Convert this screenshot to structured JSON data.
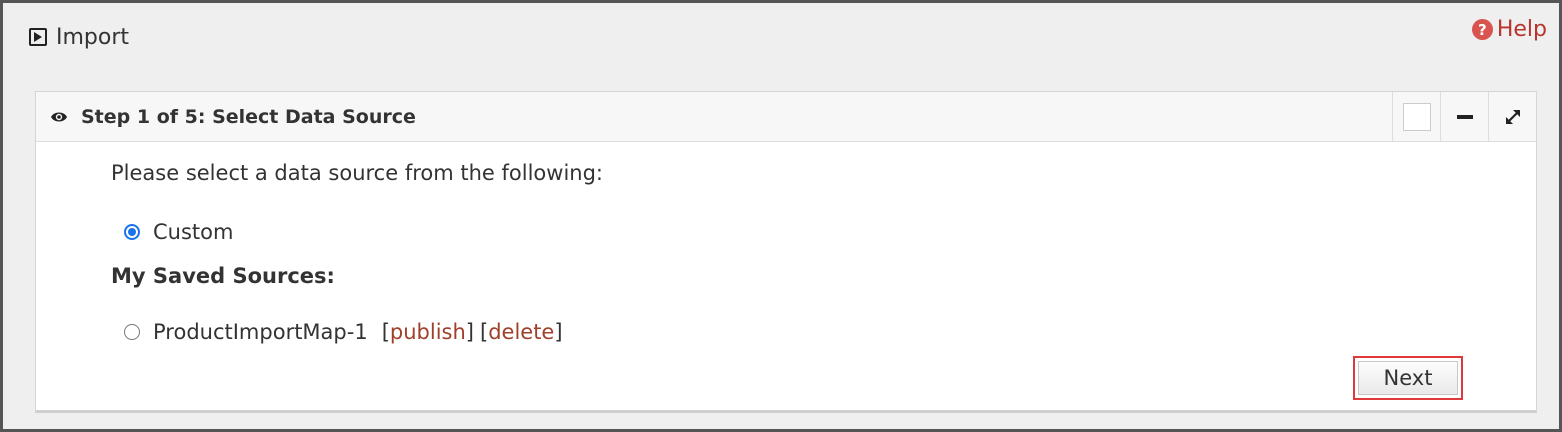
{
  "header": {
    "title": "Import",
    "help_label": "Help"
  },
  "panel": {
    "title": "Step 1 of 5: Select Data Source",
    "prompt": "Please select a data source from the following:",
    "options": [
      {
        "label": "Custom",
        "selected": true
      }
    ],
    "saved_heading": "My Saved Sources:",
    "saved_sources": [
      {
        "name": "ProductImportMap-1",
        "selected": false,
        "publish_label": "publish",
        "delete_label": "delete"
      }
    ],
    "next_label": "Next"
  },
  "icons": {
    "import": "play-square-icon",
    "help": "question-circle-icon",
    "visibility": "eye-icon",
    "minimize": "minus-icon",
    "expand": "expand-icon"
  },
  "colors": {
    "link": "#a0402a",
    "help": "#b8342f",
    "radio_selected": "#1a73e8",
    "highlight": "#e0393b"
  }
}
